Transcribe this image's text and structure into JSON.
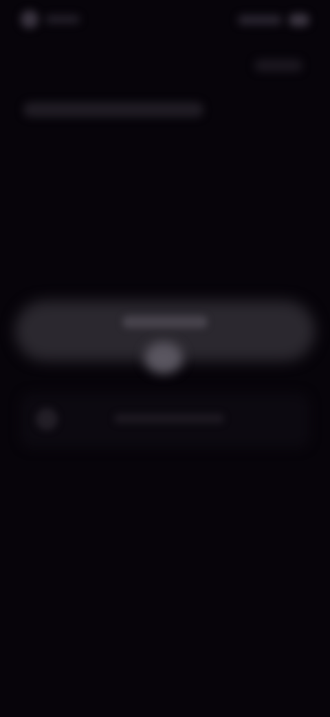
{
  "screen": {
    "background": "#07040a",
    "blurred": true
  },
  "status_bar": {
    "left_icon": "status-dot-icon",
    "right_icon": "battery-icon"
  },
  "header": {
    "action_icon": "top-right-action"
  },
  "main": {
    "primary_button_icon": "primary-action",
    "center_knob_icon": "toggle-knob-icon"
  },
  "list": {
    "row_icon": "list-row-icon"
  }
}
